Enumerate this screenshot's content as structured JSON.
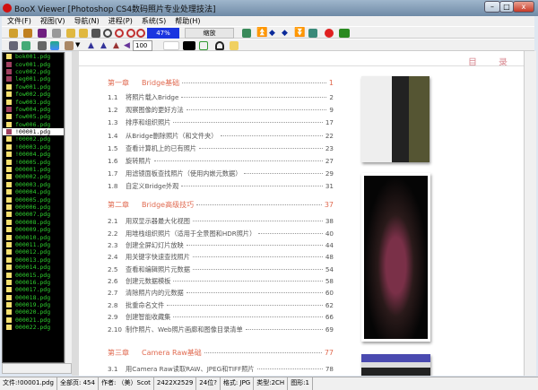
{
  "window": {
    "title": "BooX Viewer [Photoshop CS4数码照片专业处理技法]",
    "minimize": "–",
    "maximize": "□",
    "close": "x"
  },
  "menu": [
    "文件(F)",
    "视图(V)",
    "导航(N)",
    "进程(P)",
    "系统(S)",
    "帮助(H)"
  ],
  "toolbar": {
    "zoom_percent": "47%",
    "zoom_button": "缩放",
    "spin_value": "100"
  },
  "files": [
    {
      "name": "bok001.pdg",
      "type": "page"
    },
    {
      "name": "cov001.pdg",
      "type": "image"
    },
    {
      "name": "cov002.pdg",
      "type": "image"
    },
    {
      "name": "leg001.pdg",
      "type": "image"
    },
    {
      "name": "fow001.pdg",
      "type": "page"
    },
    {
      "name": "fow002.pdg",
      "type": "page"
    },
    {
      "name": "fow003.pdg",
      "type": "page"
    },
    {
      "name": "fow004.pdg",
      "type": "image"
    },
    {
      "name": "fow005.pdg",
      "type": "page"
    },
    {
      "name": "fow006.pdg",
      "type": "page"
    },
    {
      "name": "!00001.pdg",
      "type": "image",
      "selected": true
    },
    {
      "name": "!00002.pdg",
      "type": "page"
    },
    {
      "name": "!00003.pdg",
      "type": "page"
    },
    {
      "name": "!00004.pdg",
      "type": "page"
    },
    {
      "name": "!00005.pdg",
      "type": "page"
    },
    {
      "name": "000001.pdg",
      "type": "page"
    },
    {
      "name": "000002.pdg",
      "type": "page"
    },
    {
      "name": "000003.pdg",
      "type": "page"
    },
    {
      "name": "000004.pdg",
      "type": "page"
    },
    {
      "name": "000005.pdg",
      "type": "page"
    },
    {
      "name": "000006.pdg",
      "type": "page"
    },
    {
      "name": "000007.pdg",
      "type": "page"
    },
    {
      "name": "000008.pdg",
      "type": "page"
    },
    {
      "name": "000009.pdg",
      "type": "page"
    },
    {
      "name": "000010.pdg",
      "type": "page"
    },
    {
      "name": "000011.pdg",
      "type": "page"
    },
    {
      "name": "000012.pdg",
      "type": "page"
    },
    {
      "name": "000013.pdg",
      "type": "page"
    },
    {
      "name": "000014.pdg",
      "type": "page"
    },
    {
      "name": "000015.pdg",
      "type": "page"
    },
    {
      "name": "000016.pdg",
      "type": "page"
    },
    {
      "name": "000017.pdg",
      "type": "page"
    },
    {
      "name": "000018.pdg",
      "type": "page"
    },
    {
      "name": "000019.pdg",
      "type": "page"
    },
    {
      "name": "000020.pdg",
      "type": "page"
    },
    {
      "name": "000021.pdg",
      "type": "page"
    },
    {
      "name": "000022.pdg",
      "type": "page"
    }
  ],
  "page": {
    "header": [
      "目",
      "录"
    ],
    "toc": [
      {
        "num": "第一章",
        "title": "Bridge基础",
        "page": "1",
        "chapter": true
      },
      {
        "num": "1.1",
        "title": "将照片载入Bridge",
        "page": "2"
      },
      {
        "num": "1.2",
        "title": "观察图像的更好方法",
        "page": "9"
      },
      {
        "num": "1.3",
        "title": "排序和组织照片",
        "page": "17"
      },
      {
        "num": "1.4",
        "title": "从Bridge删除照片（和文件夹）",
        "page": "22"
      },
      {
        "num": "1.5",
        "title": "查看计算机上的已有照片",
        "page": "23"
      },
      {
        "num": "1.6",
        "title": "旋转照片",
        "page": "27"
      },
      {
        "num": "1.7",
        "title": "用滤镜面板查找照片（使用内嵌元数据）",
        "page": "29"
      },
      {
        "num": "1.8",
        "title": "自定义Bridge外观",
        "page": "31"
      },
      {
        "num": "第二章",
        "title": "Bridge高级技巧",
        "page": "37",
        "chapter": true
      },
      {
        "num": "2.1",
        "title": "用双显示器最大化视图",
        "page": "38"
      },
      {
        "num": "2.2",
        "title": "用堆栈组织照片（适用于全景图和HDR照片）",
        "page": "40"
      },
      {
        "num": "2.3",
        "title": "创建全屏幻灯片放映",
        "page": "44"
      },
      {
        "num": "2.4",
        "title": "用关键字快速查找照片",
        "page": "48"
      },
      {
        "num": "2.5",
        "title": "查看和编辑照片元数据",
        "page": "54"
      },
      {
        "num": "2.6",
        "title": "创建元数据模板",
        "page": "58"
      },
      {
        "num": "2.7",
        "title": "清除照片内的元数据",
        "page": "60"
      },
      {
        "num": "2.8",
        "title": "批重命名文件",
        "page": "62"
      },
      {
        "num": "2.9",
        "title": "创建智能收藏集",
        "page": "66"
      },
      {
        "num": "2.10",
        "title": "制作照片、Web照片画廊和图像目录清单",
        "page": "69"
      },
      {
        "num": "第三章",
        "title": "Camera Raw基础",
        "page": "77",
        "chapter": true
      },
      {
        "num": "3.1",
        "title": "用Camera Raw读取RAW、JPEG和TIFF照片",
        "page": "78"
      }
    ]
  },
  "status": [
    "文件:!00001.pdg",
    "全部页:  454",
    "作者: （美）Scot",
    "2422X2529",
    "24位?",
    "格式: JPG",
    "类型:2CH",
    "图形:1"
  ],
  "colors": {
    "accent": "#e06a50",
    "list_text": "#2fd02f",
    "zoom_bar": "#1a35e0"
  }
}
